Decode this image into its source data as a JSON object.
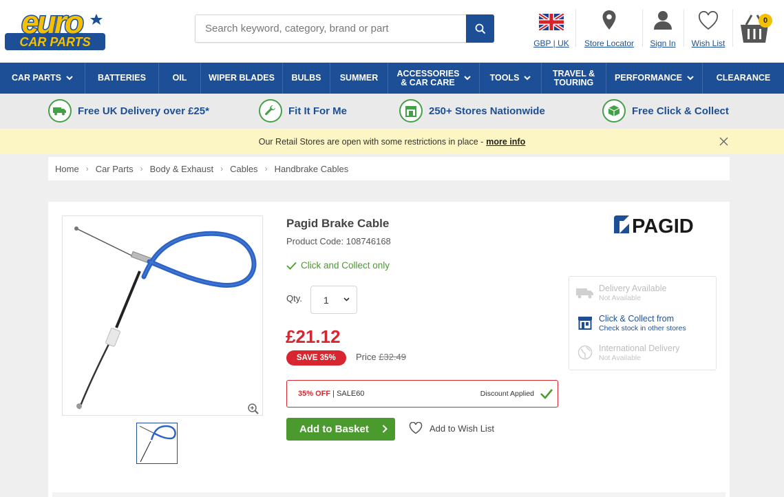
{
  "header": {
    "logo_top": "euro",
    "logo_bottom": "CAR PARTS",
    "search_placeholder": "Search keyword, category, brand or part",
    "links": [
      {
        "label": "GBP | UK",
        "icon": "uk-flag-icon"
      },
      {
        "label": "Store Locator",
        "icon": "map-pin-icon"
      },
      {
        "label": "Sign In",
        "icon": "user-icon"
      },
      {
        "label": "Wish List",
        "icon": "heart-icon"
      }
    ],
    "cart_count": "0"
  },
  "nav": [
    {
      "label": "CAR PARTS",
      "chevron": true
    },
    {
      "label": "BATTERIES",
      "chevron": false
    },
    {
      "label": "OIL",
      "chevron": false
    },
    {
      "label": "WIPER BLADES",
      "chevron": false
    },
    {
      "label": "BULBS",
      "chevron": false
    },
    {
      "label": "SUMMER",
      "chevron": false
    },
    {
      "label": "ACCESSORIES & CAR CARE",
      "chevron": true
    },
    {
      "label": "TOOLS",
      "chevron": true
    },
    {
      "label": "TRAVEL & TOURING",
      "chevron": false
    },
    {
      "label": "PERFORMANCE",
      "chevron": true
    },
    {
      "label": "CLEARANCE",
      "chevron": false
    }
  ],
  "usp": [
    {
      "label": "Free UK Delivery over £25*",
      "icon": "delivery-van-icon"
    },
    {
      "label": "Fit It For Me",
      "icon": "wrench-icon"
    },
    {
      "label": "250+ Stores Nationwide",
      "icon": "store-icon"
    },
    {
      "label": "Free Click & Collect",
      "icon": "box-icon"
    }
  ],
  "notice": {
    "text": "Our Retail Stores are open with some restrictions in place -",
    "link": "more info"
  },
  "breadcrumb": [
    "Home",
    "Car Parts",
    "Body & Exhaust",
    "Cables",
    "Handbrake Cables"
  ],
  "product": {
    "title": "Pagid Brake Cable",
    "code": "Product Code: 108746168",
    "availability": "Click and Collect only",
    "qty_label": "Qty.",
    "qty_value": "1",
    "price": "£21.12",
    "save_badge": "SAVE 35%",
    "was_label": "Price",
    "was_price": "£32.49",
    "discount_off": "35% OFF",
    "discount_code": "SALE60",
    "discount_status": "Discount Applied",
    "add_button": "Add to Basket",
    "wishlist": "Add to Wish List",
    "brand": "PAGID"
  },
  "delivery": [
    {
      "title": "Delivery Available",
      "sub": "Not Available",
      "enabled": false,
      "icon": "delivery-van-icon"
    },
    {
      "title": "Click & Collect from",
      "sub": "Check stock in other stores",
      "enabled": true,
      "icon": "store-icon"
    },
    {
      "title": "International Delivery",
      "sub": "Not Available",
      "enabled": false,
      "icon": "globe-icon"
    }
  ],
  "colors": {
    "brand_blue": "#1d4f96",
    "logo_yellow": "#f5c000",
    "price_red": "#d7262f",
    "green": "#4a9a2d"
  }
}
